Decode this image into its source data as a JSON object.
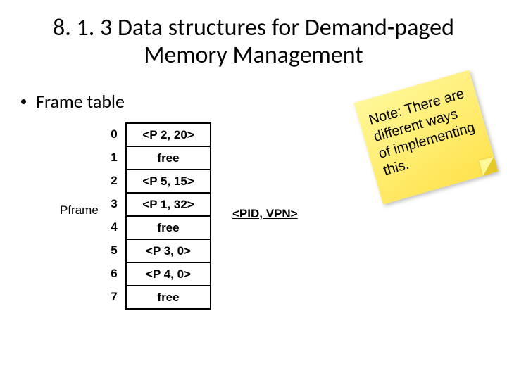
{
  "title": "8. 1. 3 Data structures for Demand-paged Memory Management",
  "bullet": "Frame table",
  "pframe_label": "Pframe",
  "frame_table": {
    "indices": [
      "0",
      "1",
      "2",
      "3",
      "4",
      "5",
      "6",
      "7"
    ],
    "entries": [
      "<P 2, 20>",
      "free",
      "<P 5, 15>",
      "<P 1, 32>",
      "free",
      "<P 3, 0>",
      "<P 4, 0>",
      "free"
    ]
  },
  "legend": "<PID, VPN>",
  "note": "Note: There are different ways of implementing this."
}
